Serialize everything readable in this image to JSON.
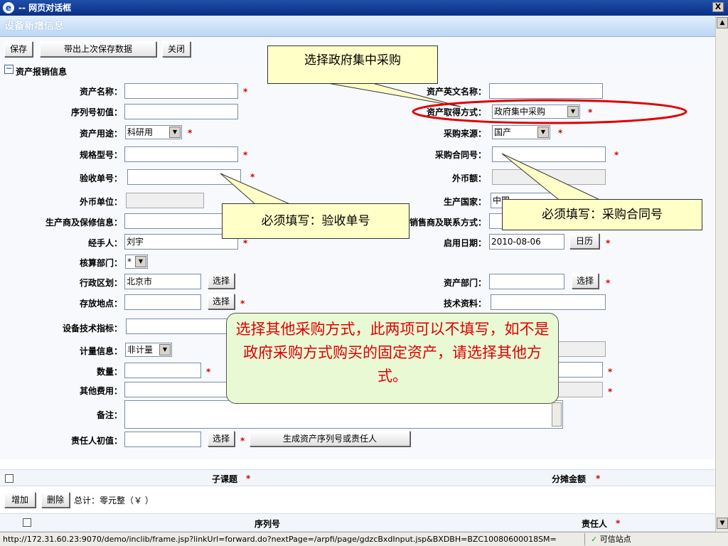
{
  "window": {
    "title": "-- 网页对话框",
    "close_glyph": "X"
  },
  "form": {
    "title": "设备新增信息"
  },
  "toolbar": {
    "save": "保存",
    "bring_last": "带出上次保存数据",
    "close": "关闭"
  },
  "section": {
    "toggle": "−",
    "title": "资产报销信息"
  },
  "required_mark": "*",
  "fields": {
    "asset_name": {
      "label": "资产名称：",
      "value": ""
    },
    "asset_en_name": {
      "label": "资产英文名称：",
      "value": ""
    },
    "serial_init": {
      "label": "序列号初值：",
      "value": ""
    },
    "acquire_mode": {
      "label": "资产取得方式：",
      "value": "政府集中采购"
    },
    "usage": {
      "label": "资产用途：",
      "value": "科研用"
    },
    "purchase_source": {
      "label": "采购来源：",
      "value": "国产"
    },
    "spec_model": {
      "label": "规格型号：",
      "value": ""
    },
    "purchase_contract": {
      "label": "采购合同号：",
      "value": ""
    },
    "acceptance_no": {
      "label": "验收单号：",
      "value": ""
    },
    "foreign_amount": {
      "label": "外币额：",
      "value": ""
    },
    "foreign_unit": {
      "label": "外币单位：",
      "value": ""
    },
    "country": {
      "label": "生产国家：",
      "value": "中国"
    },
    "maker_warranty": {
      "label": "生产商及保修信息：",
      "value": ""
    },
    "seller_contact": {
      "label": "销售商及联系方式：",
      "value": ""
    },
    "handler": {
      "label": "经手人：",
      "value": "刘宇"
    },
    "start_date": {
      "label": "启用日期：",
      "value": "2010-08-06",
      "button": "日历"
    },
    "accounting_dept": {
      "label": "核算部门：",
      "value": "*"
    },
    "region": {
      "label": "行政区划：",
      "value": "北京市",
      "button": "选择"
    },
    "asset_dept": {
      "label": "资产部门：",
      "value": "",
      "button": "选择"
    },
    "storage": {
      "label": "存放地点：",
      "value": "",
      "button": "选择"
    },
    "tech_docs": {
      "label": "技术资料：",
      "value": ""
    },
    "tech_index": {
      "label": "设备技术指标：",
      "value": ""
    },
    "metering": {
      "label": "计量信息：",
      "value": "非计量"
    },
    "quantity": {
      "label": "数量：",
      "value": ""
    },
    "other_cost": {
      "label": "其他费用：",
      "value": ""
    },
    "remark": {
      "label": "备注：",
      "value": ""
    },
    "owner_init": {
      "label": "责任人初值：",
      "value": "",
      "button": "选择"
    },
    "generate": {
      "button": "生成资产序列号或责任人"
    }
  },
  "callouts": {
    "gov_purchase": "选择政府集中采购",
    "acceptance_required": "必须填写：验收单号",
    "contract_required": "必须填写：采购合同号",
    "other_purchase": "选择其他采购方式，此两项可以不填写，如不是政府采购方式购买的固定资产，请选择其他方式。"
  },
  "subtable": {
    "col_subject": "子课题",
    "col_amount": "分摊金额",
    "add": "增加",
    "delete": "删除",
    "total": "总计：零元整（￥ ）",
    "col_serial": "序列号",
    "col_owner": "责任人"
  },
  "statusbar": {
    "url": "http://172.31.60.23:9070/demo/inclib/frame.jsp?linkUrl=forward.do?nextPage=/arpfi/page/gdzcBxdInput.jsp&BXDBH=BZC10080600018SM=",
    "zone": "可信站点",
    "zone_icon": "✓"
  },
  "colors": {
    "titlebar": "#0b2f86",
    "required": "#d40000",
    "callout_bg": "#ffffc8",
    "callout_green": "#e9f9d4",
    "ellipse": "#e00000"
  }
}
